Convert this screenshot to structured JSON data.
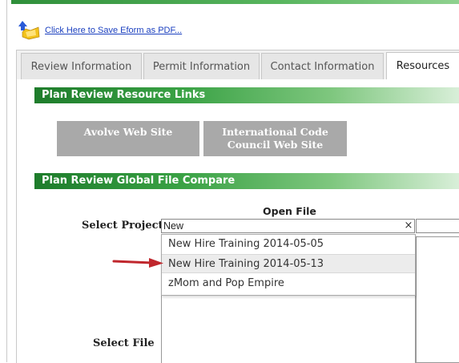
{
  "toolbar": {
    "save_pdf_link": "Click Here to Save Eform as PDF..."
  },
  "tabs": [
    {
      "label": "Review Information"
    },
    {
      "label": "Permit Information"
    },
    {
      "label": "Contact Information"
    },
    {
      "label": "Resources",
      "active": true
    }
  ],
  "resources": {
    "section_title": "Plan Review Resource Links",
    "buttons": [
      {
        "line1": "Avolve Web Site",
        "line2": ""
      },
      {
        "line1": "International Code",
        "line2": "Council Web Site"
      }
    ]
  },
  "compare": {
    "section_title": "Plan Review Global File Compare",
    "open_file_header": "Open File",
    "select_project_label": "Select Project",
    "project_input_value": "New",
    "clear_glyph": "×",
    "select_file_label": "Select File",
    "dropdown_options": [
      {
        "label": "New Hire Training 2014-05-05",
        "highlighted": false
      },
      {
        "label": "New Hire Training 2014-05-13",
        "highlighted": true
      },
      {
        "label": "zMom and Pop Empire",
        "highlighted": false
      }
    ]
  },
  "colors": {
    "section_bar": "#3aa245",
    "button_gray": "#a9a9a9",
    "link_blue": "#1a3fbf",
    "arrow_red": "#c0272d"
  },
  "icons": {
    "pdf": "pdf-save-icon",
    "arrow": "red-arrow-pointer-icon"
  }
}
